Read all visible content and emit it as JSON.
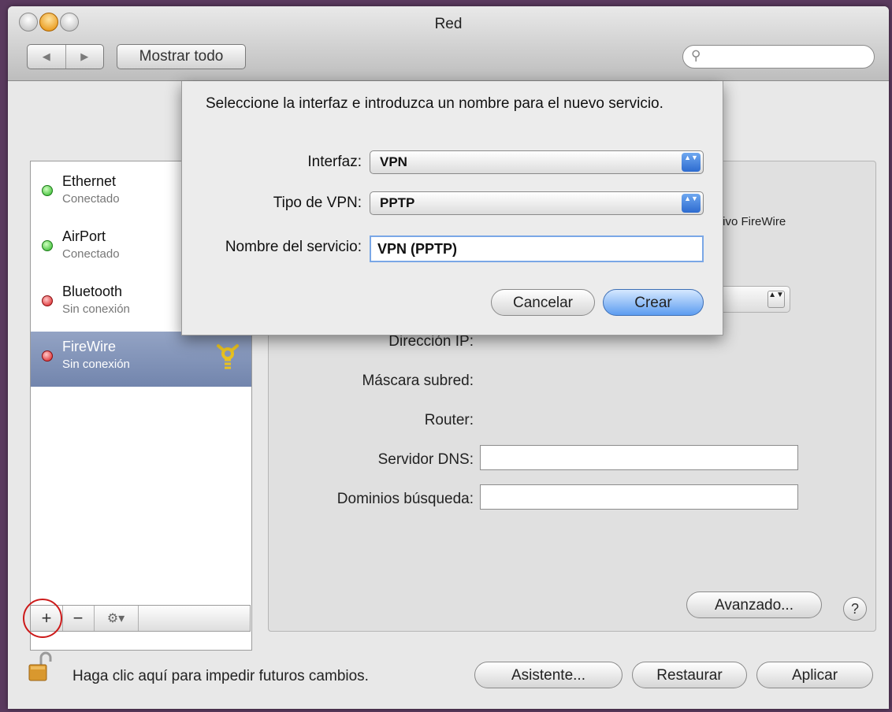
{
  "window": {
    "title": "Red"
  },
  "toolbar": {
    "back_glyph": "◀",
    "forward_glyph": "▶",
    "show_all_label": "Mostrar todo",
    "search_placeholder": "",
    "search_icon": "magnifier-icon"
  },
  "sidebar": {
    "services": [
      {
        "name": "Ethernet",
        "status": "Conectado",
        "state": "green",
        "icon": "ethernet-arrows-icon"
      },
      {
        "name": "AirPort",
        "status": "Conectado",
        "state": "green",
        "icon": "airport-wifi-icon"
      },
      {
        "name": "Bluetooth",
        "status": "Sin conexión",
        "state": "red",
        "icon": "bluetooth-icon"
      },
      {
        "name": "FireWire",
        "status": "Sin conexión",
        "state": "red",
        "icon": "firewire-icon",
        "selected": true
      }
    ],
    "add_glyph": "+",
    "remove_glyph": "−",
    "gear_glyph": "⚙▾"
  },
  "panel": {
    "status_partial": "tivo FireWire",
    "fields": [
      {
        "label": "Dirección IP:"
      },
      {
        "label": "Máscara subred:"
      },
      {
        "label": "Router:"
      },
      {
        "label": "Servidor DNS:",
        "value": ""
      },
      {
        "label": "Dominios búsqueda:",
        "value": ""
      }
    ],
    "advanced_label": "Avanzado...",
    "help_glyph": "?"
  },
  "footer": {
    "lock_text": "Haga clic aquí para impedir futuros cambios.",
    "assistant_label": "Asistente...",
    "revert_label": "Restaurar",
    "apply_label": "Aplicar"
  },
  "sheet": {
    "message": "Seleccione la interfaz e introduzca un nombre para el nuevo servicio.",
    "interface_label": "Interfaz:",
    "interface_value": "VPN",
    "vpn_type_label": "Tipo de VPN:",
    "vpn_type_value": "PPTP",
    "service_name_label": "Nombre del servicio:",
    "service_name_value": "VPN (PPTP)",
    "cancel_label": "Cancelar",
    "create_label": "Crear",
    "popup_arrows": "▲▼"
  },
  "colors": {
    "selection": "#7c8fb5",
    "default_button": "#5c9cf0",
    "connected": "#26b320",
    "disconnected": "#d7161a",
    "annotation_ring": "#cc1a1a"
  }
}
